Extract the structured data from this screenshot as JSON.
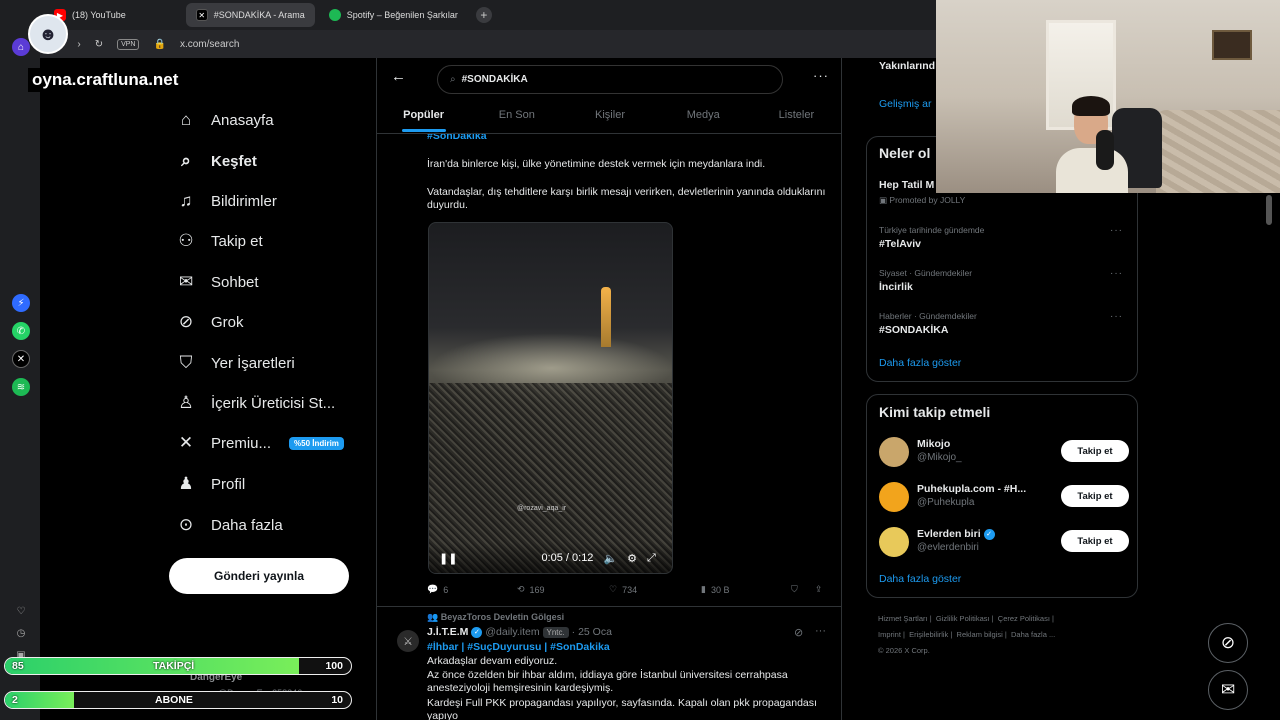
{
  "browser": {
    "tabs": [
      {
        "label": "(18) YouTube",
        "icon": "youtube-icon",
        "color": "#ff0000"
      },
      {
        "label": "#SONDAKİKA - Arama",
        "icon": "x-icon",
        "color": "#000000"
      },
      {
        "label": "Spotify – Beğenilen Şarkılar",
        "icon": "spotify-icon",
        "color": "#1db954"
      }
    ],
    "url": "x.com/search",
    "vpn_label": "VPN"
  },
  "overlay": {
    "site_text": "oyna.craftluna.net"
  },
  "nav": {
    "items": [
      {
        "label": "Anasayfa",
        "icon": "home-icon",
        "glyph": "⌂"
      },
      {
        "label": "Keşfet",
        "icon": "search-icon",
        "glyph": "⌕"
      },
      {
        "label": "Bildirimler",
        "icon": "bell-icon",
        "glyph": "🔔"
      },
      {
        "label": "Takip et",
        "icon": "add-user-icon",
        "glyph": "👤"
      },
      {
        "label": "Sohbet",
        "icon": "mail-icon",
        "glyph": "✉"
      },
      {
        "label": "Grok",
        "icon": "grok-icon",
        "glyph": "⊘"
      },
      {
        "label": "Yer İşaretleri",
        "icon": "bookmark-icon",
        "glyph": "🔖"
      },
      {
        "label": "İçerik Üreticisi St...",
        "icon": "creator-icon",
        "glyph": "♙"
      },
      {
        "label": "Premiu...",
        "icon": "x-logo-icon",
        "glyph": "✕"
      },
      {
        "label": "Profil",
        "icon": "profile-icon",
        "glyph": "♟"
      },
      {
        "label": "Daha fazla",
        "icon": "more-circle-icon",
        "glyph": "⊙"
      }
    ],
    "premium_badge": "%50 İndirim",
    "post_button": "Gönderi yayınla"
  },
  "search": {
    "query": "#SONDAKİKA",
    "tabs": [
      "Popüler",
      "En Son",
      "Kişiler",
      "Medya",
      "Listeler"
    ]
  },
  "post1": {
    "hashtag_top": "#SonDakika",
    "line1": "İran'da binlerce kişi, ülke yönetimine destek vermek için meydanlara indi.",
    "line2": "Vatandaşlar, dış tehditlere karşı birlik mesajı verirken, devletlerinin yanında olduklarını duyurdu.",
    "video_time": "0:05 / 0:12",
    "video_watermark": "@rozavi_aqa_ir",
    "replies": "6",
    "reposts": "169",
    "likes": "734",
    "views": "30 B"
  },
  "post2": {
    "context": "BeyazToros Devletin Gölgesi",
    "author": "J.İ.T.E.M",
    "handle": "@daily.item",
    "badge": "Yntc.",
    "date": "· 25 Oca",
    "tags": "#İhbar | #SuçDuyurusu | #SonDakika",
    "line1": "Arkadaşlar devam ediyoruz.",
    "line2": "Az önce özelden bir ihbar aldım, iddiaya göre İstanbul üniversitesi cerrahpasa anesteziyoloji hemşiresinin kardeşiymiş.",
    "line3": "Kardeşi Full PKK propagandası yapılıyor, sayfasında. Kapalı olan pkk propagandası yapıyo"
  },
  "right": {
    "partial_top1": "Yakınlarınd",
    "partial_top2": "Gelişmiş ar",
    "trends_title": "Neler ol",
    "promoted_name": "Hep Tatil M",
    "promoted_by": "Promoted by JOLLY",
    "trends": [
      {
        "meta": "Türkiye tarihinde gündemde",
        "name": "#TelAviv"
      },
      {
        "meta": "Siyaset · Gündemdekiler",
        "name": "İncirlik"
      },
      {
        "meta": "Haberler · Gündemdekiler",
        "name": "#SONDAKİKA"
      }
    ],
    "show_more": "Daha fazla göster",
    "who_title": "Kimi takip etmeli",
    "who": [
      {
        "name": "Mikojo",
        "handle": "@Mikojo_",
        "color": "#c9a66b",
        "verified": false
      },
      {
        "name": "Puhekupla.com - #H...",
        "handle": "@Puhekupla",
        "color": "#f2a41c",
        "verified": false
      },
      {
        "name": "Evlerden biri",
        "handle": "@evlerdenbiri",
        "color": "#e8c95a",
        "verified": true
      }
    ],
    "follow_label": "Takip et",
    "who_show_more": "Daha fazla göster",
    "footer": [
      "Hizmet Şartları",
      "|",
      "Gizlilik Politikası",
      "|",
      "Çerez Politikası",
      "|",
      "Imprint",
      "|",
      "Erişilebilirlik",
      "|",
      "Reklam bilgisi",
      "|",
      "Daha fazla ...",
      "© 2026 X Corp."
    ]
  },
  "stream": {
    "followers": {
      "current": "85",
      "label": "TAKİPÇİ",
      "goal": "100",
      "fraction": 0.85
    },
    "subs": {
      "current": "2",
      "label": "ABONE",
      "goal": "10",
      "fraction": 0.2
    },
    "obscured_name": "DangerEye",
    "obscured_handle": "@DangerEye258246"
  }
}
